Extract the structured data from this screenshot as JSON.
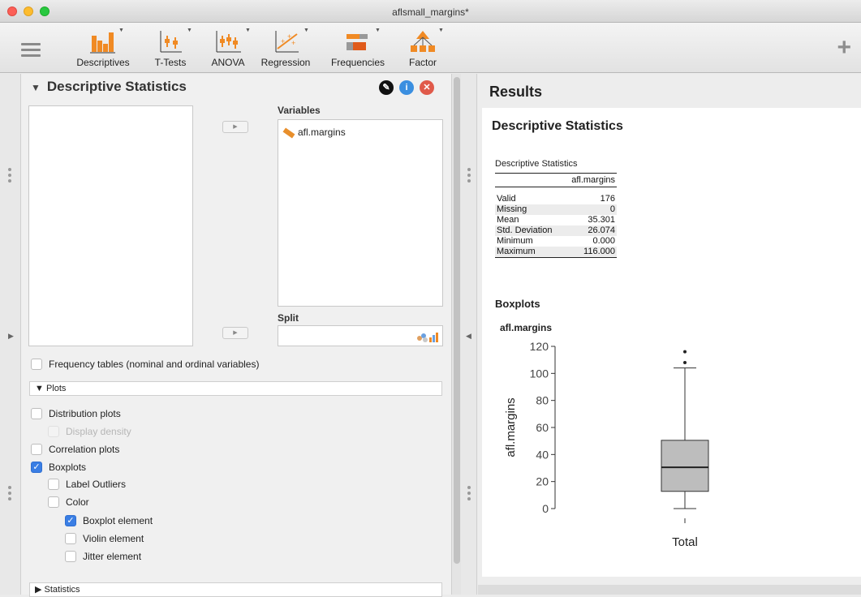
{
  "window": {
    "title": "aflsmall_margins*"
  },
  "toolbar": {
    "items": [
      {
        "label": "Descriptives"
      },
      {
        "label": "T-Tests"
      },
      {
        "label": "ANOVA"
      },
      {
        "label": "Regression"
      },
      {
        "label": "Frequencies"
      },
      {
        "label": "Factor"
      }
    ],
    "plus": "+"
  },
  "analysis": {
    "title": "Descriptive Statistics",
    "variables_label": "Variables",
    "variables": [
      "afl.margins"
    ],
    "split_label": "Split",
    "frequency_tables": "Frequency tables (nominal and ordinal variables)",
    "plots_section": "Plots",
    "distribution_plots": "Distribution plots",
    "display_density": "Display density",
    "correlation_plots": "Correlation plots",
    "boxplots": "Boxplots",
    "label_outliers": "Label Outliers",
    "color": "Color",
    "boxplot_element": "Boxplot element",
    "violin_element": "Violin element",
    "jitter_element": "Jitter element",
    "statistics_section": "Statistics",
    "move_arrow": "▶"
  },
  "results": {
    "title": "Results",
    "section_title": "Descriptive Statistics",
    "table_title": "Descriptive Statistics",
    "table_column": "afl.margins",
    "rows": [
      {
        "label": "Valid",
        "value": "176"
      },
      {
        "label": "Missing",
        "value": "0"
      },
      {
        "label": "Mean",
        "value": "35.301"
      },
      {
        "label": "Std. Deviation",
        "value": "26.074"
      },
      {
        "label": "Minimum",
        "value": "0.000"
      },
      {
        "label": "Maximum",
        "value": "116.000"
      }
    ],
    "boxplots_title": "Boxplots",
    "plot_title": "afl.margins"
  },
  "chart_data": {
    "type": "boxplot",
    "title": "afl.margins",
    "ylabel": "afl.margins",
    "xlabel": "Total",
    "yticks": [
      0,
      20,
      40,
      60,
      80,
      100,
      120
    ],
    "ylim": [
      0,
      120
    ],
    "box": {
      "min": 0,
      "q1": 12.75,
      "median": 30.5,
      "q3": 50.5,
      "max": 104,
      "outliers": [
        108,
        116
      ]
    },
    "color": "#bdbdbd"
  }
}
